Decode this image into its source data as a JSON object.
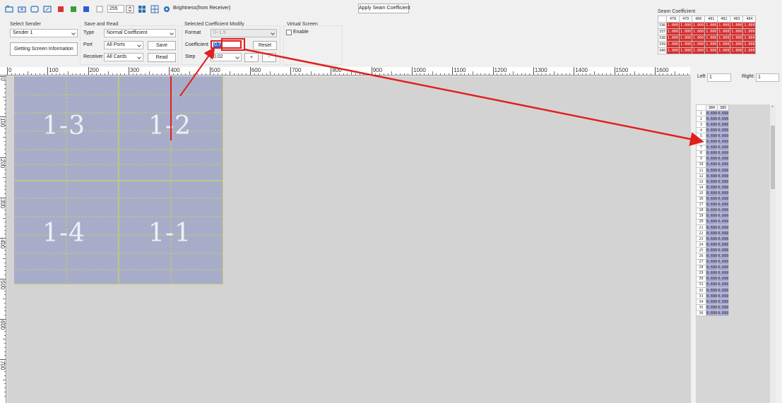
{
  "toolbar": {
    "brightness_value": "255",
    "brightness_label": "Brightness(from Receiver)",
    "apply_seam_label": "Apply Seam Coefficient",
    "icons": [
      "open-folder-icon",
      "save-folder-icon",
      "screen-outline-icon",
      "screen-refresh-icon",
      "red-square-icon",
      "green-square-icon",
      "blue-square-icon",
      "white-square-icon",
      "spin-icon",
      "layout-icon",
      "crosshair-icon",
      "gear-icon"
    ]
  },
  "select_sender": {
    "title": "Select Sender",
    "sender_value": "Sender 1",
    "get_info_label": "Getting Screen Information"
  },
  "save_read": {
    "title": "Save and Read",
    "type_label": "Type",
    "type_value": "Normal Coefficient",
    "port_label": "Port",
    "port_value": "All Ports",
    "save_label": "Save",
    "receiver_label": "Receiver",
    "receiver_value": "All Cards",
    "read_label": "Read"
  },
  "coef_modify": {
    "title": "Selected Coefficient Modify",
    "format_label": "Format",
    "format_value": "0~1.5",
    "coefficient_label": "Coefficient",
    "coefficient_value": "0.7",
    "reset_label": "Reset",
    "step_label": "Step",
    "step_value": "0.02",
    "plus_label": "+",
    "minus_label": "-"
  },
  "virtual_screen": {
    "title": "Virtual Screen",
    "enable_label": "Enable"
  },
  "seam": {
    "title": "Seam Coefficient",
    "columns": [
      "478",
      "479",
      "480",
      "481",
      "482",
      "483",
      "484"
    ],
    "rows": [
      {
        "num": "336",
        "values": [
          "1.000",
          "1.000",
          "1.000",
          "1.000",
          "1.000",
          "1.000",
          "1.000"
        ]
      },
      {
        "num": "337",
        "values": [
          "1.000",
          "1.000",
          "1.000",
          "1.000",
          "1.000",
          "1.000",
          "1.000"
        ]
      },
      {
        "num": "338",
        "values": [
          "1.000",
          "1.000",
          "1.000",
          "1.000",
          "1.000",
          "1.000",
          "1.000"
        ]
      },
      {
        "num": "339",
        "values": [
          "1.000",
          "1.000",
          "1.000",
          "1.000",
          "1.000",
          "1.000",
          "1.000"
        ]
      },
      {
        "num": "340",
        "values": [
          "1.000",
          "1.000",
          "1.000",
          "1.000",
          "1.000",
          "1.000",
          "1.000"
        ]
      }
    ],
    "highlight_color": "#d92b2b"
  },
  "ruler": {
    "h_ticks": [
      "0",
      "100",
      "200",
      "300",
      "400",
      "500",
      "600",
      "700",
      "800",
      "900",
      "1000",
      "1100",
      "1200",
      "1300",
      "1400",
      "1500",
      "1600"
    ],
    "v_ticks": [
      "0",
      "100",
      "200",
      "300",
      "400",
      "500",
      "600",
      "700"
    ]
  },
  "cabinets": [
    {
      "label": "1-3"
    },
    {
      "label": "1-2"
    },
    {
      "label": "1-4"
    },
    {
      "label": "1-1"
    }
  ],
  "right_panel": {
    "left_label": "Left",
    "left_value": "1",
    "right_label": "Right:",
    "right_value": "1",
    "columns": [
      "384",
      "385"
    ],
    "rows": [
      "1",
      "2",
      "3",
      "4",
      "5",
      "6",
      "7",
      "8",
      "9",
      "10",
      "11",
      "12",
      "13",
      "14",
      "15",
      "16",
      "17",
      "18",
      "19",
      "20",
      "21",
      "22",
      "23",
      "24",
      "25",
      "26",
      "27",
      "28",
      "29",
      "30",
      "31",
      "32",
      "33",
      "34",
      "35",
      "36"
    ],
    "cell_value": "0.699",
    "cell_color": "#a6a8d6"
  },
  "annotation_color": "#e02020"
}
